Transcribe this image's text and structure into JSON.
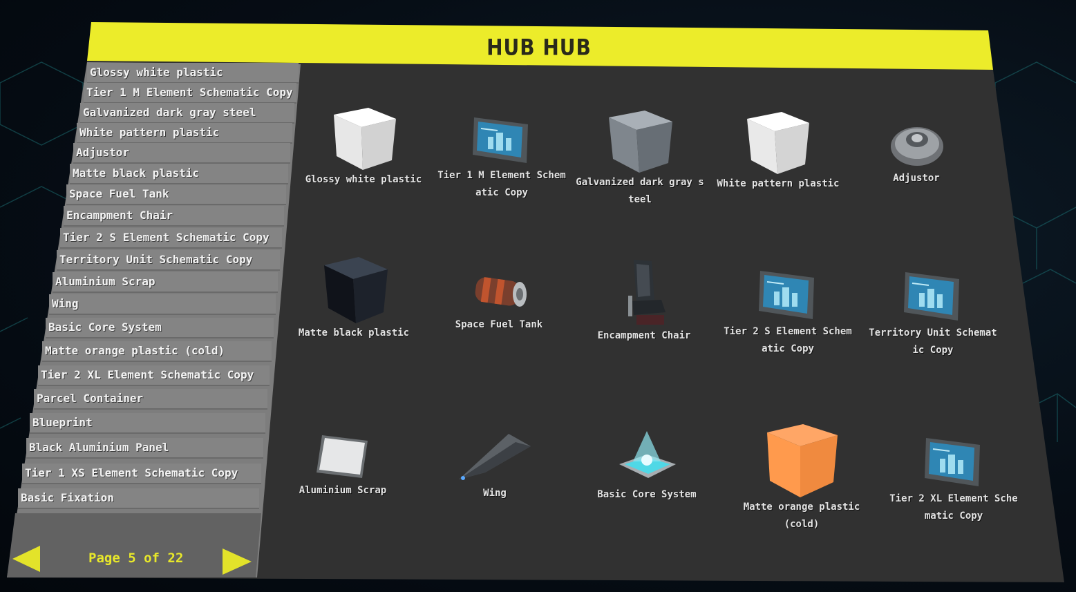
{
  "window": {
    "title": "HUB HUB"
  },
  "sidebar": {
    "items": [
      {
        "label": "Glossy white plastic"
      },
      {
        "label": "Tier 1 M Element Schematic Copy"
      },
      {
        "label": "Galvanized dark gray steel"
      },
      {
        "label": "White pattern plastic"
      },
      {
        "label": "Adjustor"
      },
      {
        "label": "Matte black plastic"
      },
      {
        "label": "Space Fuel Tank"
      },
      {
        "label": "Encampment Chair"
      },
      {
        "label": "Tier 2 S Element Schematic Copy"
      },
      {
        "label": "Territory Unit Schematic Copy"
      },
      {
        "label": "Aluminium Scrap"
      },
      {
        "label": "Wing"
      },
      {
        "label": "Basic Core System"
      },
      {
        "label": "Matte orange plastic (cold)"
      },
      {
        "label": "Tier 2 XL Element Schematic Copy"
      },
      {
        "label": "Parcel Container"
      },
      {
        "label": "Blueprint"
      },
      {
        "label": "Black Aluminium Panel"
      },
      {
        "label": "Tier 1 XS Element Schematic Copy"
      },
      {
        "label": "Basic Fixation"
      }
    ]
  },
  "pagination": {
    "label": "Page 5 of 22",
    "current": 5,
    "total": 22,
    "prev_icon": "arrow-left-icon",
    "next_icon": "arrow-right-icon"
  },
  "grid": {
    "items": [
      {
        "label": "Glossy white plastic",
        "icon": "white-cube-icon"
      },
      {
        "label": "Tier 1 M Element Schematic Copy",
        "icon": "schematic-icon"
      },
      {
        "label": "Galvanized dark gray steel",
        "icon": "gray-cube-icon"
      },
      {
        "label": "White pattern plastic",
        "icon": "white-cube-icon"
      },
      {
        "label": "Adjustor",
        "icon": "adjustor-icon"
      },
      {
        "label": "Matte black plastic",
        "icon": "black-cube-icon"
      },
      {
        "label": "Space Fuel Tank",
        "icon": "fuel-tank-icon"
      },
      {
        "label": "Encampment Chair",
        "icon": "chair-icon"
      },
      {
        "label": "Tier 2 S Element Schematic Copy",
        "icon": "schematic-icon"
      },
      {
        "label": "Territory Unit Schematic Copy",
        "icon": "schematic-icon"
      },
      {
        "label": "Aluminium Scrap",
        "icon": "scrap-icon"
      },
      {
        "label": "Wing",
        "icon": "wing-icon"
      },
      {
        "label": "Basic Core System",
        "icon": "core-system-icon"
      },
      {
        "label": "Matte orange plastic (cold)",
        "icon": "orange-cube-icon"
      },
      {
        "label": "Tier 2 XL Element Schematic Copy",
        "icon": "schematic-icon"
      }
    ]
  },
  "colors": {
    "header": "#ecec2a",
    "panel": "#313131",
    "sidebar": "#7d7d7d",
    "accent": "#e8e82a"
  }
}
